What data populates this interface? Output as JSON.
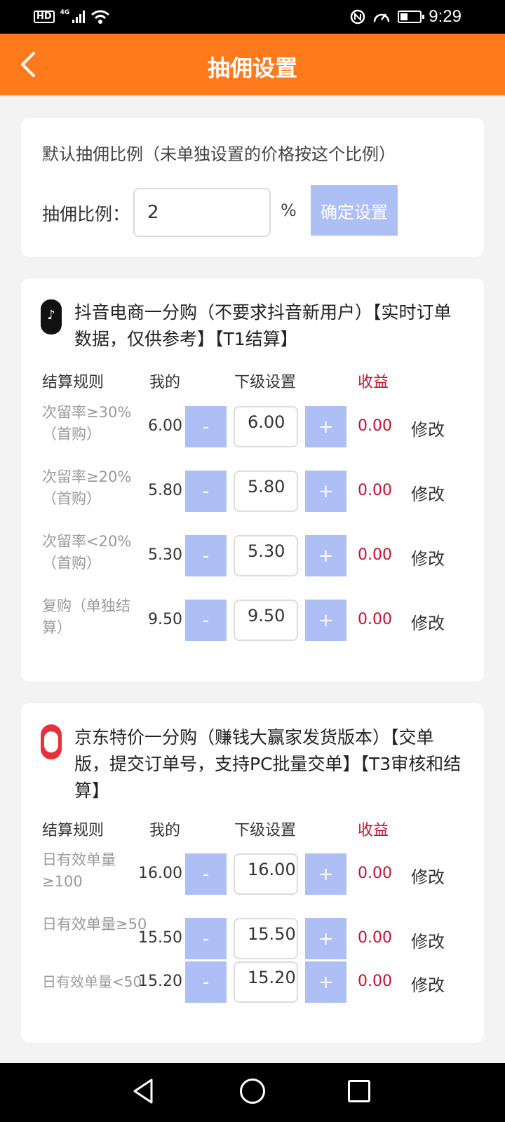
{
  "status_bar": {
    "hd": "HD",
    "network": "4G",
    "time": "9:29"
  },
  "header": {
    "title": "抽佣设置"
  },
  "default_section": {
    "description": "默认抽佣比例（未单独设置的价格按这个比例）",
    "ratio_label": "抽佣比例：",
    "ratio_value": "2",
    "percent": "%",
    "confirm_label": "确定设置"
  },
  "table_headers": {
    "rule": "结算规则",
    "mine": "我的",
    "sub": "下级设置",
    "income": "收益"
  },
  "actions": {
    "minus": "-",
    "plus": "+",
    "modify": "修改"
  },
  "platforms": [
    {
      "icon": "tiktok-icon",
      "title": "抖音电商一分购（不要求抖音新用户）【实时订单数据，仅供参考】【T1结算】",
      "rows": [
        {
          "rule": "次留率≥30%（首购）",
          "mine": "6.00",
          "sub": "6.00",
          "income": "0.00"
        },
        {
          "rule": "次留率≥20%（首购）",
          "mine": "5.80",
          "sub": "5.80",
          "income": "0.00"
        },
        {
          "rule": "次留率<20%（首购）",
          "mine": "5.30",
          "sub": "5.30",
          "income": "0.00"
        },
        {
          "rule": "复购（单独结算）",
          "mine": "9.50",
          "sub": "9.50",
          "income": "0.00"
        }
      ]
    },
    {
      "icon": "jd-mascot-icon",
      "title": "京东特价一分购（赚钱大赢家发货版本）【交单版，提交订单号，支持PC批量交单】【T3审核和结算】",
      "rows": [
        {
          "rule": "日有效单量≥100",
          "mine": "16.00",
          "sub": "16.00",
          "income": "0.00"
        },
        {
          "rule": "日有效单量≥50",
          "mine": "15.50",
          "sub": "15.50",
          "income": "0.00"
        },
        {
          "rule": "日有效单量<50",
          "mine": "15.20",
          "sub": "15.20",
          "income": "0.00"
        }
      ]
    }
  ],
  "colors": {
    "primary": "#ff7a1a",
    "button": "#aebff5",
    "income": "#c8102e",
    "background": "#f3f3f3"
  }
}
